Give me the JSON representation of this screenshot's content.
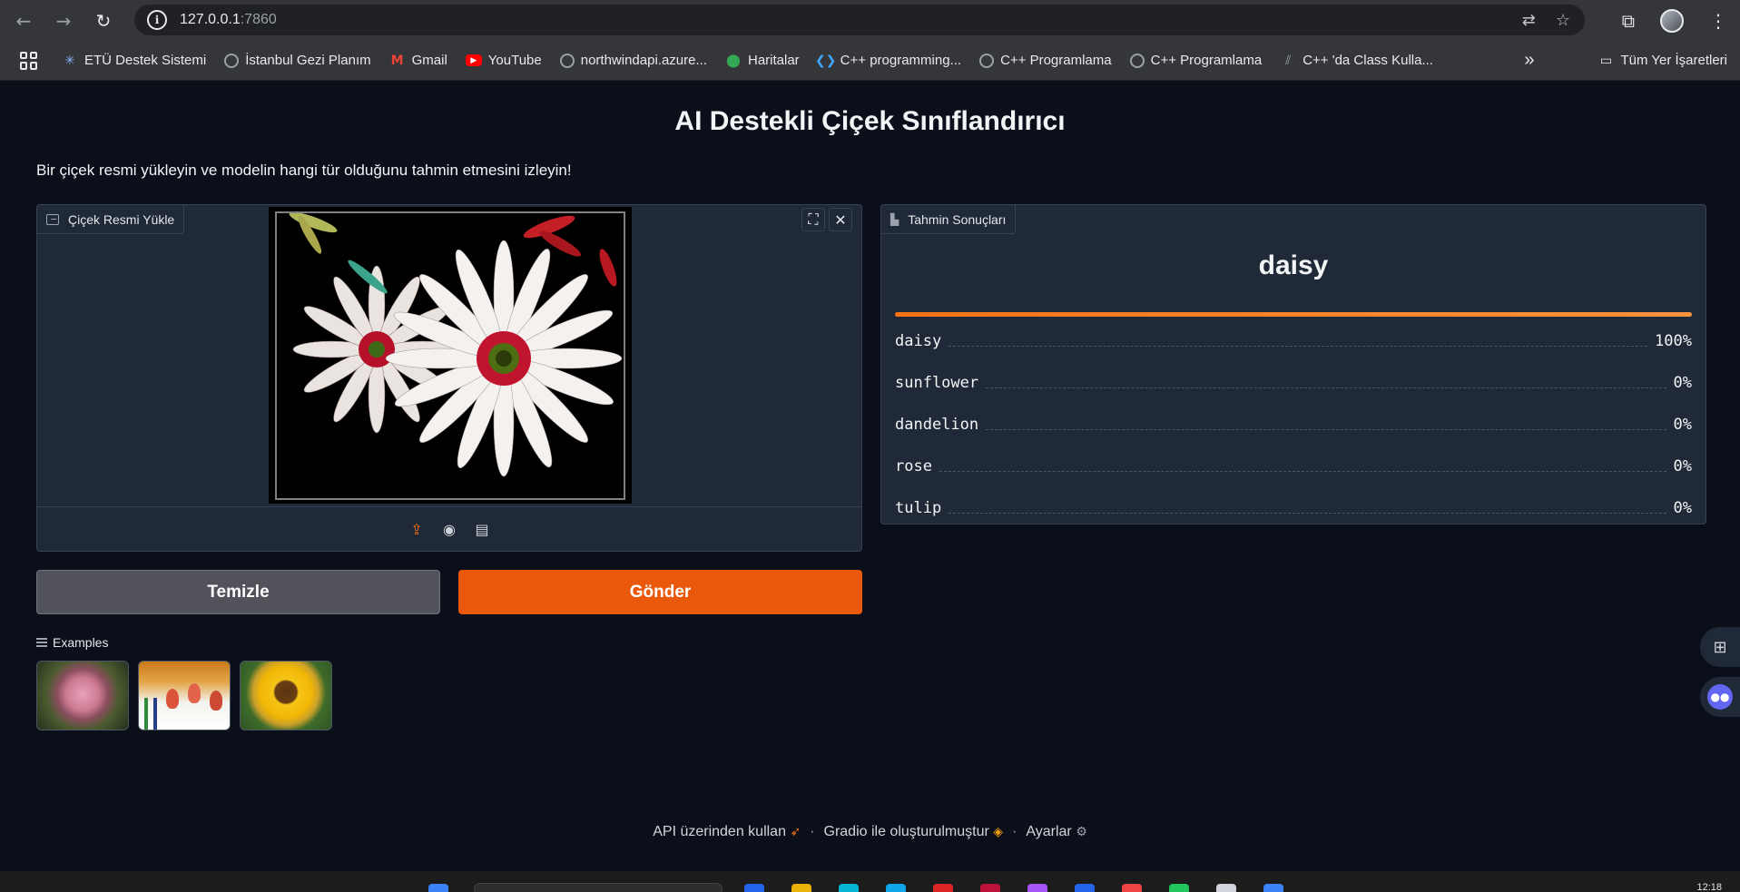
{
  "browser": {
    "url_host": "127.0.0.1",
    "url_port": ":7860",
    "bookmarks": [
      {
        "label": "ETÜ Destek Sistemi",
        "icon": "star-burst-icon"
      },
      {
        "label": "İstanbul Gezi Planım",
        "icon": "globe-icon"
      },
      {
        "label": "Gmail",
        "icon": "gmail-icon"
      },
      {
        "label": "YouTube",
        "icon": "youtube-icon"
      },
      {
        "label": "northwindapi.azure...",
        "icon": "globe-icon"
      },
      {
        "label": "Haritalar",
        "icon": "maps-icon"
      },
      {
        "label": "C++ programming...",
        "icon": "vscode-icon"
      },
      {
        "label": "C++ Programlama",
        "icon": "globe-icon"
      },
      {
        "label": "C++ Programlama",
        "icon": "globe-icon"
      },
      {
        "label": "C++ 'da Class Kulla...",
        "icon": "link-icon"
      }
    ],
    "more_bookmarks": "»",
    "all_bookmarks": "Tüm Yer İşaretleri"
  },
  "app": {
    "title": "AI Destekli Çiçek Sınıflandırıcı",
    "description": "Bir çiçek resmi yükleyin ve modelin hangi tür olduğunu tahmin etmesini izleyin!",
    "upload_label": "Çiçek Resmi Yükle",
    "result_label": "Tahmin Sonuçları",
    "top_prediction": "daisy",
    "top_confidence": 1.0,
    "confidences": [
      {
        "label": "daisy",
        "pct": "100%"
      },
      {
        "label": "sunflower",
        "pct": "0%"
      },
      {
        "label": "dandelion",
        "pct": "0%"
      },
      {
        "label": "rose",
        "pct": "0%"
      },
      {
        "label": "tulip",
        "pct": "0%"
      }
    ],
    "clear_button": "Temizle",
    "submit_button": "Gönder",
    "examples_label": "Examples",
    "examples": [
      "rose",
      "tulip",
      "sunflower"
    ]
  },
  "footer": {
    "api": "API üzerinden kullan",
    "gradio": "Gradio ile oluşturulmuştur",
    "settings": "Ayarlar",
    "sep": "·"
  },
  "taskbar": {
    "time": "12:18"
  },
  "colors": {
    "accent": "#ea580c",
    "background": "#0b0f19",
    "panel": "#1f2937"
  }
}
